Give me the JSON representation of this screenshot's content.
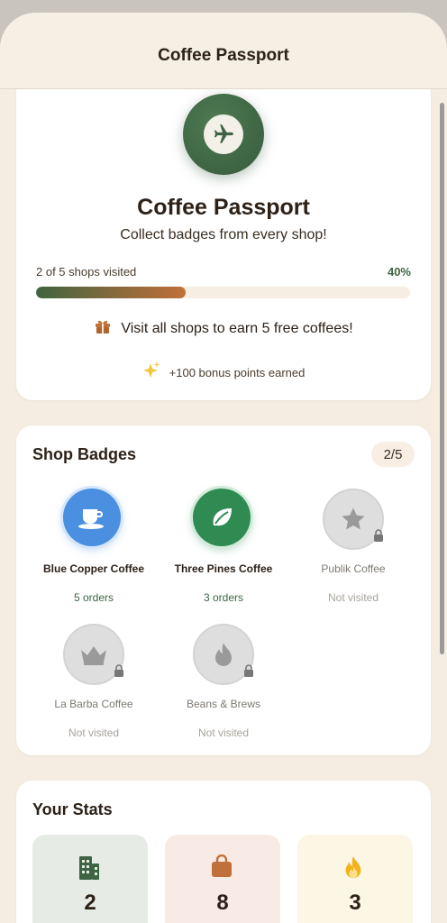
{
  "header": {
    "title": "Coffee Passport"
  },
  "hero": {
    "icon": "airplane-icon",
    "title": "Coffee Passport",
    "subtitle": "Collect badges from every shop!",
    "progress_label": "2 of 5 shops visited",
    "progress_percent": "40%",
    "progress_fraction": 0.4,
    "reward_icon": "gift-icon",
    "reward_text": "Visit all shops to earn 5 free coffees!",
    "bonus_icon": "sparkles-icon",
    "bonus_text": "+100 bonus points earned"
  },
  "badges": {
    "title": "Shop Badges",
    "count": "2/5",
    "items": [
      {
        "name": "Blue Copper Coffee",
        "meta": "5 orders",
        "icon": "coffee-cup-icon",
        "visited": true,
        "color": "#4a8fe0"
      },
      {
        "name": "Three Pines Coffee",
        "meta": "3 orders",
        "icon": "leaf-icon",
        "visited": true,
        "color": "#2f8b52"
      },
      {
        "name": "Publik Coffee",
        "meta": "Not visited",
        "icon": "star-icon",
        "visited": false
      },
      {
        "name": "La Barba Coffee",
        "meta": "Not visited",
        "icon": "crown-icon",
        "visited": false
      },
      {
        "name": "Beans & Brews",
        "meta": "Not visited",
        "icon": "flame-icon",
        "visited": false
      }
    ]
  },
  "stats": {
    "title": "Your Stats",
    "tiles": [
      {
        "icon": "building-icon",
        "value": "2",
        "bg": "#e6ebe5"
      },
      {
        "icon": "bag-icon",
        "value": "8",
        "bg": "#f8ebe5"
      },
      {
        "icon": "fire-icon",
        "value": "3",
        "bg": "#fcf6e4"
      }
    ]
  },
  "colors": {
    "accent_green": "#3d6443",
    "accent_brown": "#c0703a",
    "background": "#f5ede1"
  }
}
